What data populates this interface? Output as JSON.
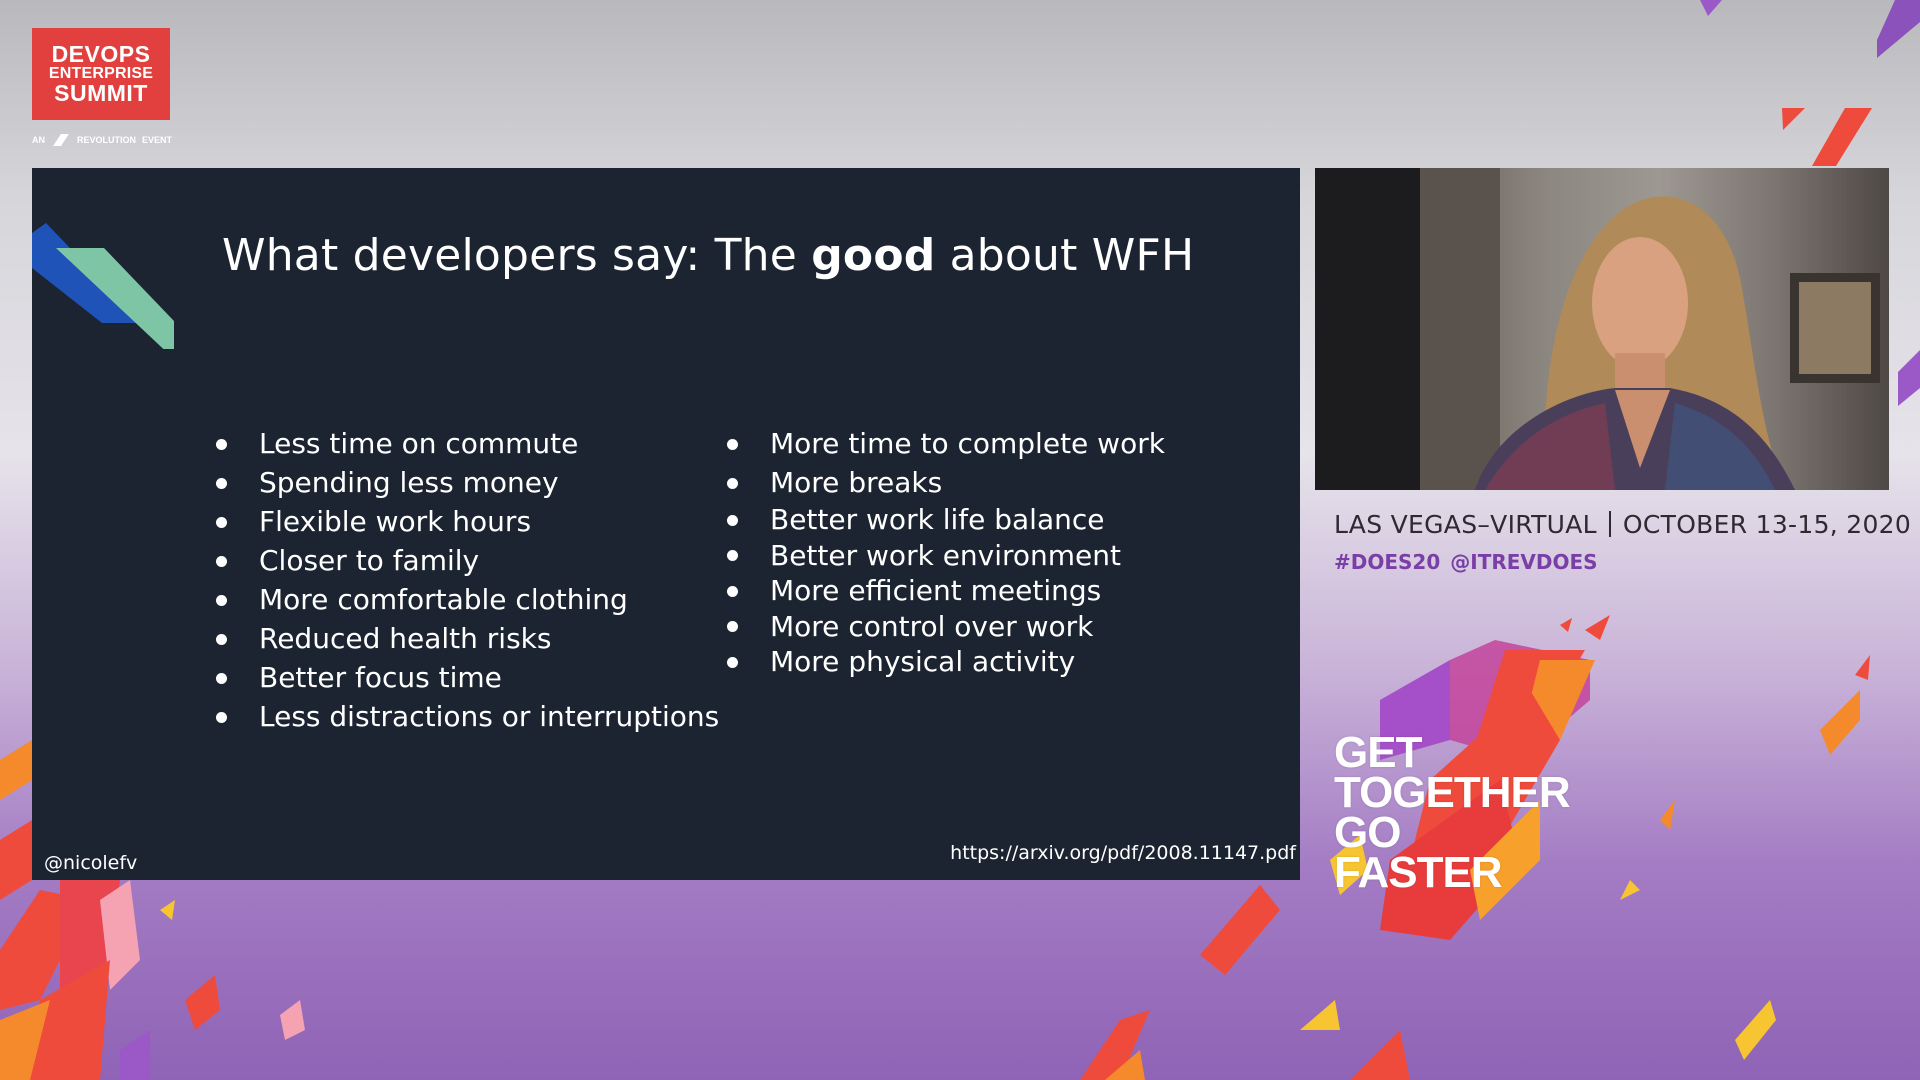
{
  "logo": {
    "line1": "DEVOPS",
    "line2": "ENTERPRISE",
    "line3": "SUMMIT",
    "sub_prefix": "AN",
    "sub_brand": "REVOLUTION",
    "sub_suffix": "EVENT",
    "color": "#e2403f"
  },
  "slide": {
    "title_before": "What developers say: The ",
    "title_bold": "good",
    "title_after": " about WFH",
    "left_items": [
      "Less time on commute",
      "Spending less money",
      "Flexible work hours",
      "Closer to family",
      "More comfortable clothing",
      "Reduced health risks",
      "Better focus time",
      "Less distractions or interruptions"
    ],
    "right_items": [
      "More time to complete work",
      "More breaks",
      "Better work life balance",
      "Better work environment",
      "More efficient meetings",
      "More control over work",
      "More physical activity"
    ],
    "handle": "@nicolefv",
    "url": "https://arxiv.org/pdf/2008.11147.pdf",
    "background": "#1b2430"
  },
  "event": {
    "location": "LAS VEGAS–VIRTUAL",
    "dates": "OCTOBER 13-15, 2020",
    "hashtag": "#DOES20",
    "twitter": "@ITREVDOES",
    "accent": "#7a3fa6"
  },
  "tagline": {
    "line1": "GET",
    "line2": "TOGETHER",
    "line3": "GO",
    "line4": "FASTER"
  }
}
